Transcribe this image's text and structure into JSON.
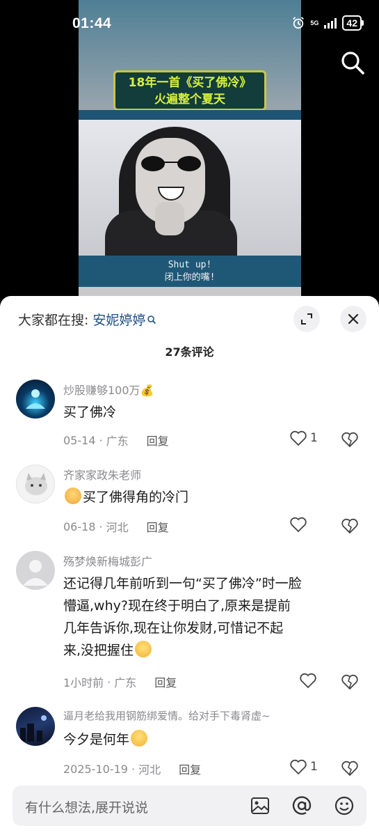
{
  "status_bar": {
    "time": "01:44",
    "network": "5G",
    "battery": "42"
  },
  "video": {
    "caption_line1": "18年一首《买了佛冷》",
    "caption_line2": "火遍整个夏天",
    "subtitle_line1": "Shut up!",
    "subtitle_line2": "闭上你的嘴!"
  },
  "panel": {
    "hot_search_label": "大家都在搜:",
    "hot_search_term": "安妮婷婷",
    "comment_count": "27条评论"
  },
  "comments": [
    {
      "name": "炒股赚够100万💰",
      "text": "买了佛冷",
      "date": "05-14",
      "location": "广东",
      "reply": "回复",
      "likes": "1"
    },
    {
      "name": "齐家家政朱老师",
      "text": "买了佛得角的冷门",
      "date": "06-18",
      "location": "河北",
      "reply": "回复",
      "likes": ""
    },
    {
      "name": "殇梦焕新梅城彭广",
      "text_line1": "还记得几年前听到一句“买了佛冷”时一脸",
      "text_line2": "懵逼,why?现在终于明白了,原来是提前",
      "text_line3": "几年告诉你,现在让你发财,可惜记不起",
      "text_line4": "来,没把握住",
      "date": "1小时前",
      "location": "广东",
      "reply": "回复",
      "likes": ""
    },
    {
      "name": "逼月老给我用钢筋绑爱情。给对手下毒肾虚~",
      "text": "今夕是何年",
      "date": "2025-10-19",
      "location": "河北",
      "reply": "回复",
      "likes": "1"
    }
  ],
  "input_bar": {
    "placeholder": "有什么想法,展开说说"
  },
  "icons": {
    "search": "search-icon",
    "expand": "expand-icon",
    "close": "close-icon",
    "like": "heart-icon",
    "dislike": "broken-heart-icon",
    "image": "image-icon",
    "mention": "at-icon",
    "emoji": "emoji-icon"
  },
  "colors": {
    "term_blue": "#1d4e89",
    "caption_green": "#d8f03f",
    "panel_bg": "#ffffff"
  }
}
